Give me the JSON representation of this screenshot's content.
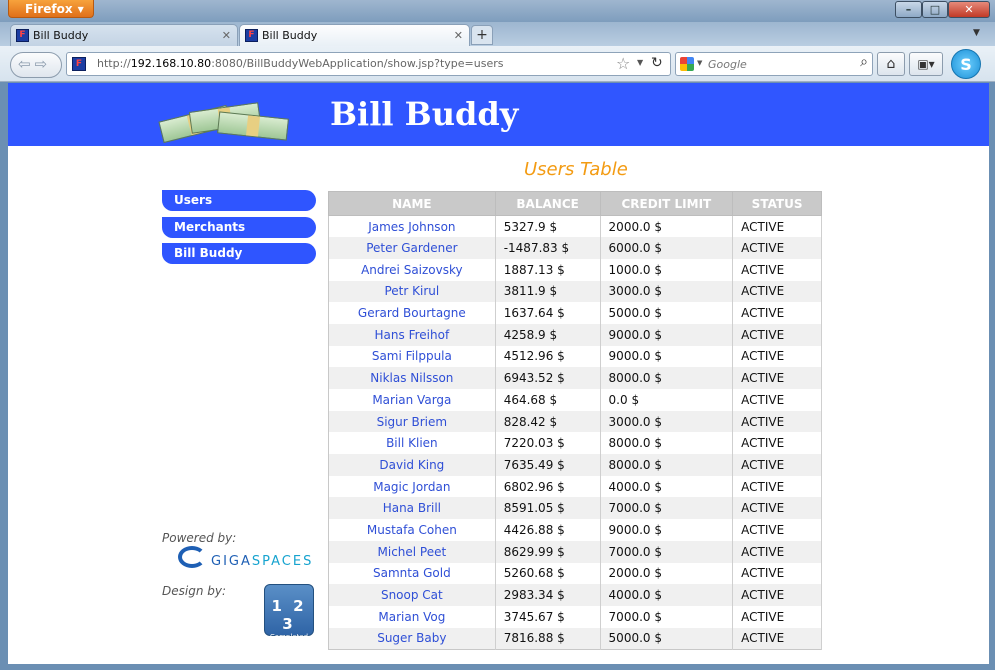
{
  "browser": {
    "menu_button": "Firefox",
    "tabs": [
      {
        "label": "Bill Buddy"
      },
      {
        "label": "Bill Buddy"
      }
    ],
    "url": {
      "scheme": "http://",
      "host": "192.168.10.80",
      "rest": ":8080/BillBuddyWebApplication/show.jsp?type=users"
    },
    "search_placeholder": "Google"
  },
  "header": {
    "title": "Bill Buddy"
  },
  "sidebar": {
    "items": [
      {
        "label": "Users"
      },
      {
        "label": "Merchants"
      },
      {
        "label": "Bill Buddy"
      }
    ],
    "powered_by": "Powered by:",
    "gigaspaces": {
      "part1": "GIGA",
      "part2": "SPACES"
    },
    "design_by": "Design by:",
    "badge": {
      "number": "1 2 3",
      "label": "Completed"
    }
  },
  "table": {
    "title": "Users Table",
    "columns": [
      "NAME",
      "BALANCE",
      "CREDIT LIMIT",
      "STATUS"
    ],
    "rows": [
      [
        "James Johnson",
        "5327.9 $",
        "2000.0 $",
        "ACTIVE"
      ],
      [
        "Peter Gardener",
        "-1487.83 $",
        "6000.0 $",
        "ACTIVE"
      ],
      [
        "Andrei Saizovsky",
        "1887.13 $",
        "1000.0 $",
        "ACTIVE"
      ],
      [
        "Petr Kirul",
        "3811.9 $",
        "3000.0 $",
        "ACTIVE"
      ],
      [
        "Gerard Bourtagne",
        "1637.64 $",
        "5000.0 $",
        "ACTIVE"
      ],
      [
        "Hans Freihof",
        "4258.9 $",
        "9000.0 $",
        "ACTIVE"
      ],
      [
        "Sami Filppula",
        "4512.96 $",
        "9000.0 $",
        "ACTIVE"
      ],
      [
        "Niklas Nilsson",
        "6943.52 $",
        "8000.0 $",
        "ACTIVE"
      ],
      [
        "Marian Varga",
        "464.68 $",
        "0.0 $",
        "ACTIVE"
      ],
      [
        "Sigur Briem",
        "828.42 $",
        "3000.0 $",
        "ACTIVE"
      ],
      [
        "Bill Klien",
        "7220.03 $",
        "8000.0 $",
        "ACTIVE"
      ],
      [
        "David King",
        "7635.49 $",
        "8000.0 $",
        "ACTIVE"
      ],
      [
        "Magic Jordan",
        "6802.96 $",
        "4000.0 $",
        "ACTIVE"
      ],
      [
        "Hana Brill",
        "8591.05 $",
        "7000.0 $",
        "ACTIVE"
      ],
      [
        "Mustafa Cohen",
        "4426.88 $",
        "9000.0 $",
        "ACTIVE"
      ],
      [
        "Michel Peet",
        "8629.99 $",
        "7000.0 $",
        "ACTIVE"
      ],
      [
        "Samnta Gold",
        "5260.68 $",
        "2000.0 $",
        "ACTIVE"
      ],
      [
        "Snoop Cat",
        "2983.34 $",
        "4000.0 $",
        "ACTIVE"
      ],
      [
        "Marian Vog",
        "3745.67 $",
        "7000.0 $",
        "ACTIVE"
      ],
      [
        "Suger Baby",
        "7816.88 $",
        "5000.0 $",
        "ACTIVE"
      ]
    ]
  },
  "colors": {
    "header_bg": "#3056ff",
    "nav_bg": "#2f55ff",
    "table_title": "#f39b12",
    "name_link": "#2f4fd6"
  }
}
